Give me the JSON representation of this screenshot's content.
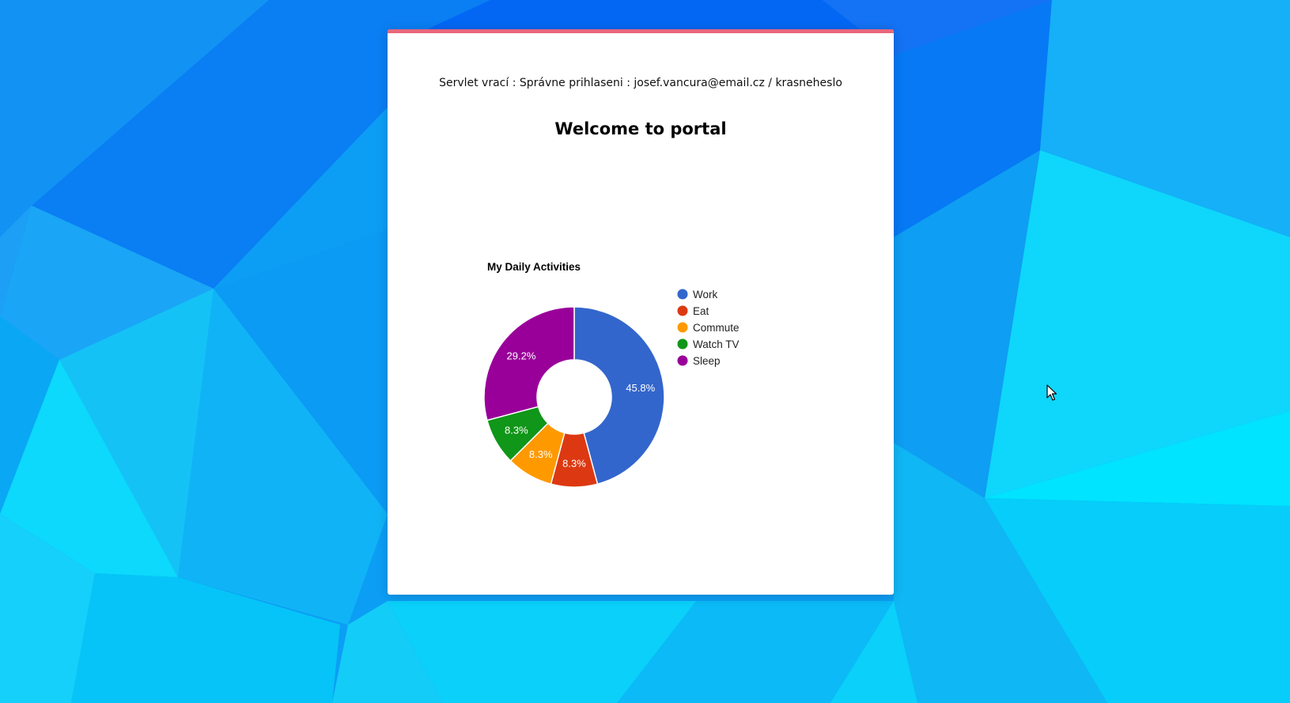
{
  "page": {
    "accent_color": "#e8677c",
    "background_colors": [
      "#0055f5",
      "#0a84f3",
      "#11c7f7",
      "#00e6ff"
    ]
  },
  "servlet_message": "Servlet vrací : Správne prihlaseni : josef.vancura@email.cz / krasneheslo",
  "page_title": "Welcome to portal",
  "chart_data": {
    "type": "pie",
    "donut": true,
    "title": "My Daily Activities",
    "legend_position": "right",
    "slices": [
      {
        "name": "Work",
        "value": 11,
        "percent_label": "45.8%",
        "color": "#3366cc"
      },
      {
        "name": "Eat",
        "value": 2,
        "percent_label": "8.3%",
        "color": "#dc3912"
      },
      {
        "name": "Commute",
        "value": 2,
        "percent_label": "8.3%",
        "color": "#ff9900"
      },
      {
        "name": "Watch TV",
        "value": 2,
        "percent_label": "8.3%",
        "color": "#109618"
      },
      {
        "name": "Sleep",
        "value": 7,
        "percent_label": "29.2%",
        "color": "#990099"
      }
    ]
  },
  "cursor": {
    "icon": "mouse-pointer-icon"
  }
}
